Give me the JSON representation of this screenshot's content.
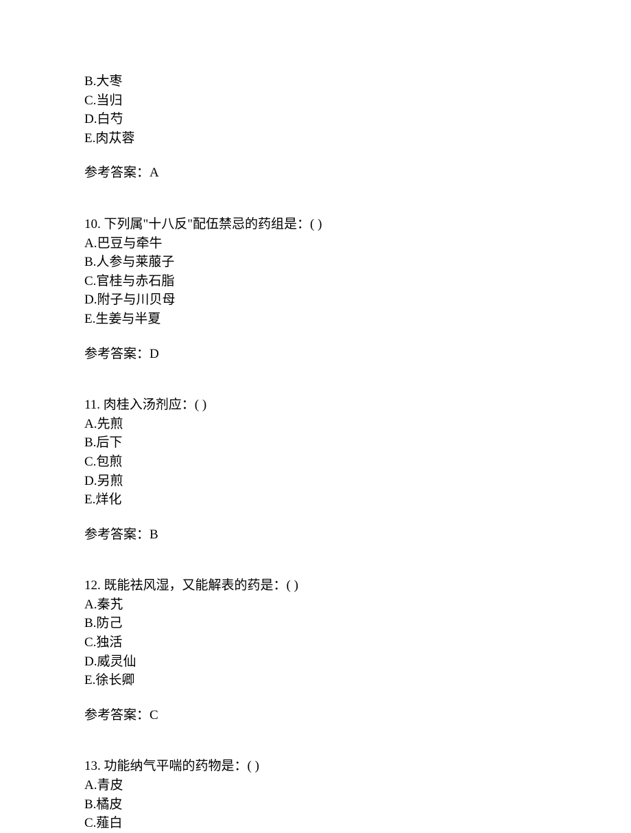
{
  "q9_partial": {
    "options": {
      "B": "B.大枣",
      "C": "C.当归",
      "D": "D.白芍",
      "E": "E.肉苁蓉"
    },
    "answer": "参考答案：A"
  },
  "q10": {
    "stem": "10. 下列属\"十八反\"配伍禁忌的药组是：( )",
    "options": {
      "A": "A.巴豆与牵牛",
      "B": "B.人参与莱菔子",
      "C": "C.官桂与赤石脂",
      "D": "D.附子与川贝母",
      "E": "E.生姜与半夏"
    },
    "answer": "参考答案：D"
  },
  "q11": {
    "stem": "11. 肉桂入汤剂应：( )",
    "options": {
      "A": "A.先煎",
      "B": "B.后下",
      "C": "C.包煎",
      "D": "D.另煎",
      "E": "E.烊化"
    },
    "answer": "参考答案：B"
  },
  "q12": {
    "stem": "12. 既能祛风湿，又能解表的药是：( )",
    "options": {
      "A": "A.秦艽",
      "B": "B.防己",
      "C": "C.独活",
      "D": "D.威灵仙",
      "E": "E.徐长卿"
    },
    "answer": "参考答案：C"
  },
  "q13": {
    "stem": "13. 功能纳气平喘的药物是：( )",
    "options": {
      "A": "A.青皮",
      "B": "B.橘皮",
      "C": "C.薤白"
    }
  }
}
